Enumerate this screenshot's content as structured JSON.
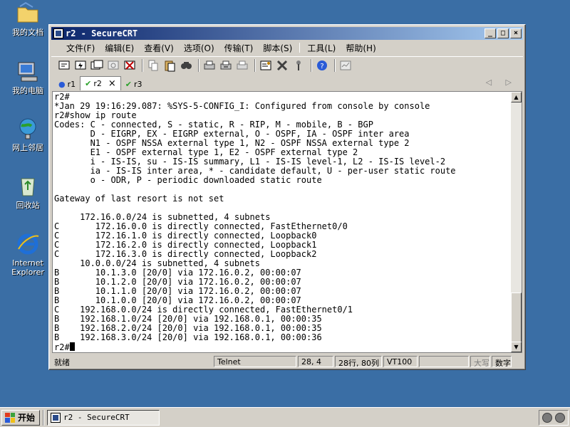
{
  "desktop": {
    "icons": [
      {
        "label": "我的文档"
      },
      {
        "label": "我的电脑"
      },
      {
        "label": "网上邻居"
      },
      {
        "label": "回收站"
      },
      {
        "label": "Internet Explorer"
      }
    ]
  },
  "window": {
    "title": "r2 - SecureCRT",
    "buttons": {
      "minimize": "_",
      "maximize": "□",
      "close": "×"
    }
  },
  "menu": {
    "items": [
      "文件(F)",
      "编辑(E)",
      "查看(V)",
      "选项(O)",
      "传输(T)",
      "脚本(S)",
      "工具(L)",
      "帮助(H)"
    ]
  },
  "tabs": [
    {
      "label": "r1",
      "status": "info"
    },
    {
      "label": "r2",
      "status": "connected",
      "active": true,
      "close": "×"
    },
    {
      "label": "r3",
      "status": "connected"
    }
  ],
  "tab_arrows": "◁ ▷",
  "terminal": {
    "lines": [
      "r2#",
      "*Jan 29 19:16:29.087: %SYS-5-CONFIG_I: Configured from console by console",
      "r2#show ip route",
      "Codes: C - connected, S - static, R - RIP, M - mobile, B - BGP",
      "       D - EIGRP, EX - EIGRP external, O - OSPF, IA - OSPF inter area",
      "       N1 - OSPF NSSA external type 1, N2 - OSPF NSSA external type 2",
      "       E1 - OSPF external type 1, E2 - OSPF external type 2",
      "       i - IS-IS, su - IS-IS summary, L1 - IS-IS level-1, L2 - IS-IS level-2",
      "       ia - IS-IS inter area, * - candidate default, U - per-user static route",
      "       o - ODR, P - periodic downloaded static route",
      "",
      "Gateway of last resort is not set",
      "",
      "     172.16.0.0/24 is subnetted, 4 subnets",
      "C       172.16.0.0 is directly connected, FastEthernet0/0",
      "C       172.16.1.0 is directly connected, Loopback0",
      "C       172.16.2.0 is directly connected, Loopback1",
      "C       172.16.3.0 is directly connected, Loopback2",
      "     10.0.0.0/24 is subnetted, 4 subnets",
      "B       10.1.3.0 [20/0] via 172.16.0.2, 00:00:07",
      "B       10.1.2.0 [20/0] via 172.16.0.2, 00:00:07",
      "B       10.1.1.0 [20/0] via 172.16.0.2, 00:00:07",
      "B       10.1.0.0 [20/0] via 172.16.0.2, 00:00:07",
      "C    192.168.0.0/24 is directly connected, FastEthernet0/1",
      "B    192.168.1.0/24 [20/0] via 192.168.0.1, 00:00:35",
      "B    192.168.2.0/24 [20/0] via 192.168.0.1, 00:00:35",
      "B    192.168.3.0/24 [20/0] via 192.168.0.1, 00:00:36"
    ],
    "prompt": "r2#"
  },
  "status": {
    "ready": "就绪",
    "protocol": "Telnet",
    "position": "28,  4",
    "size": "28行, 80列",
    "emulation": "VT100",
    "caps": "大写",
    "num": "数字"
  },
  "taskbar": {
    "start": "开始",
    "task": "r2 - SecureCRT"
  },
  "colors": {
    "desktop": "#3a6ea5",
    "titlebar_start": "#0a246a",
    "titlebar_end": "#a6caf0",
    "chrome": "#d4d0c8"
  }
}
